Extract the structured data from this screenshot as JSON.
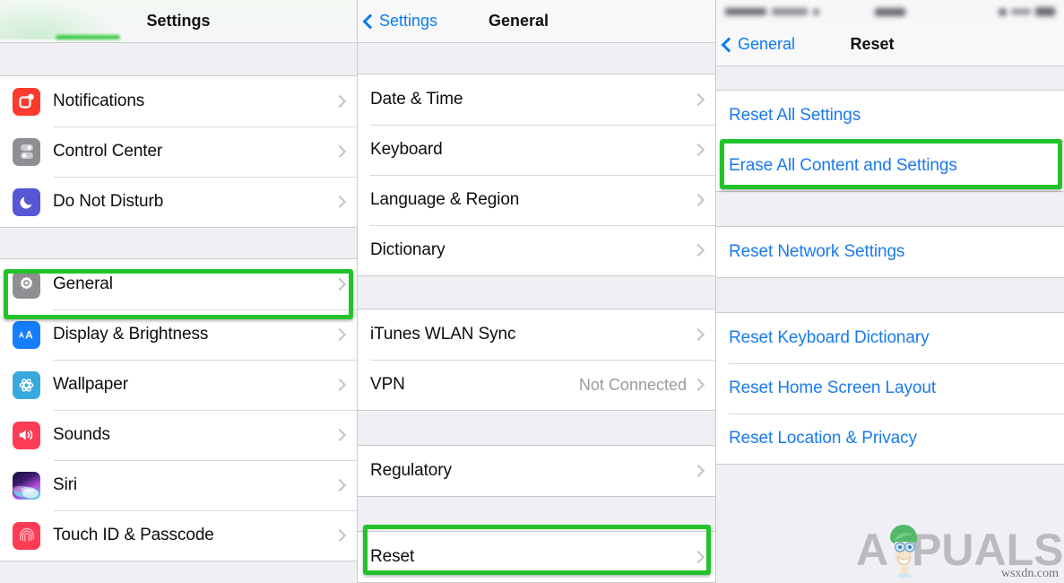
{
  "panels": {
    "settings": {
      "nav": {
        "title": "Settings"
      },
      "groups": [
        {
          "rows": [
            {
              "label": "Notifications",
              "icon": "notifications-icon",
              "accessory": "chevron-right-icon"
            },
            {
              "label": "Control Center",
              "icon": "control-center-icon",
              "accessory": "chevron-right-icon"
            },
            {
              "label": "Do Not Disturb",
              "icon": "do-not-disturb-icon",
              "accessory": "chevron-right-icon"
            }
          ]
        },
        {
          "rows": [
            {
              "label": "General",
              "icon": "general-gear-icon",
              "accessory": "chevron-right-icon",
              "highlighted": true
            },
            {
              "label": "Display & Brightness",
              "icon": "display-brightness-icon",
              "accessory": "chevron-right-icon"
            },
            {
              "label": "Wallpaper",
              "icon": "wallpaper-icon",
              "accessory": "chevron-right-icon"
            },
            {
              "label": "Sounds",
              "icon": "sounds-icon",
              "accessory": "chevron-right-icon"
            },
            {
              "label": "Siri",
              "icon": "siri-icon",
              "accessory": "chevron-right-icon"
            },
            {
              "label": "Touch ID & Passcode",
              "icon": "touch-id-icon",
              "accessory": "chevron-right-icon"
            }
          ]
        }
      ]
    },
    "general": {
      "nav": {
        "back_label": "Settings",
        "title": "General"
      },
      "groups": [
        {
          "rows": [
            {
              "label": "Date & Time",
              "accessory": "chevron-right-icon"
            },
            {
              "label": "Keyboard",
              "accessory": "chevron-right-icon"
            },
            {
              "label": "Language & Region",
              "accessory": "chevron-right-icon"
            },
            {
              "label": "Dictionary",
              "accessory": "chevron-right-icon"
            }
          ]
        },
        {
          "rows": [
            {
              "label": "iTunes WLAN Sync",
              "accessory": "chevron-right-icon"
            },
            {
              "label": "VPN",
              "value": "Not Connected",
              "accessory": "chevron-right-icon"
            }
          ]
        },
        {
          "rows": [
            {
              "label": "Regulatory",
              "accessory": "chevron-right-icon"
            }
          ]
        },
        {
          "rows": [
            {
              "label": "Reset",
              "accessory": "chevron-right-icon",
              "highlighted": true
            }
          ]
        }
      ]
    },
    "reset": {
      "statusbar": {
        "carrier": "",
        "time": "",
        "battery": ""
      },
      "nav": {
        "back_label": "General",
        "title": "Reset"
      },
      "groups": [
        {
          "rows": [
            {
              "label": "Reset All Settings",
              "style": "link"
            },
            {
              "label": "Erase All Content and Settings",
              "style": "link",
              "highlighted": true
            }
          ]
        },
        {
          "rows": [
            {
              "label": "Reset Network Settings",
              "style": "link"
            }
          ]
        },
        {
          "rows": [
            {
              "label": "Reset Keyboard Dictionary",
              "style": "link"
            },
            {
              "label": "Reset Home Screen Layout",
              "style": "link"
            },
            {
              "label": "Reset Location & Privacy",
              "style": "link"
            }
          ]
        }
      ]
    }
  },
  "watermark": {
    "brand": "APPUALS",
    "url": "wsxdn.com"
  },
  "colors": {
    "highlight_green": "#22c32a",
    "link_blue": "#1a7aee",
    "tint_blue": "#0a7cf0",
    "group_bg": "#efeff4"
  }
}
